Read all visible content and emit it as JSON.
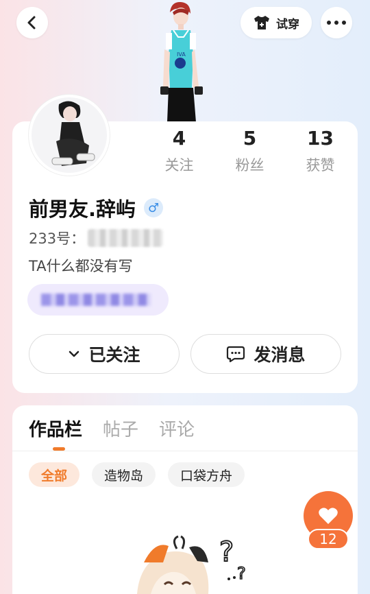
{
  "header": {
    "tryon_label": "试穿"
  },
  "profile": {
    "stats": [
      {
        "value": "4",
        "label": "关注"
      },
      {
        "value": "5",
        "label": "粉丝"
      },
      {
        "value": "13",
        "label": "获赞"
      }
    ],
    "nickname": "前男友.辞屿",
    "gender_symbol": "♂",
    "uid_label": "233号：",
    "bio": "TA什么都没有写",
    "follow_label": "已关注",
    "message_label": "发消息"
  },
  "content": {
    "tabs": [
      {
        "label": "作品栏"
      },
      {
        "label": "帖子"
      },
      {
        "label": "评论"
      }
    ],
    "chips": [
      {
        "label": "全部"
      },
      {
        "label": "造物岛"
      },
      {
        "label": "口袋方舟"
      }
    ],
    "like_count": "12"
  },
  "colors": {
    "accent": "#f07b2b",
    "like_bg": "#f5733a",
    "gender_blue": "#3b8ee6"
  }
}
